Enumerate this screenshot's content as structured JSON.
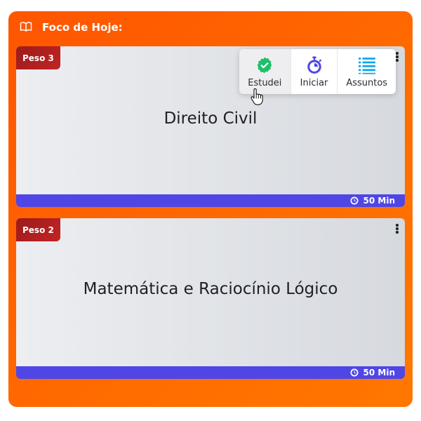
{
  "header": {
    "title": "Foco de Hoje:",
    "icon": "book-open-icon"
  },
  "cards": [
    {
      "peso": "Peso 3",
      "subject": "Direito Civil",
      "duration": "50 Min",
      "toolbar": [
        {
          "label": "Estudei",
          "icon": "check-badge-icon",
          "color": "#1fbf6a"
        },
        {
          "label": "Iniciar",
          "icon": "stopwatch-icon",
          "color": "#4f46e5"
        },
        {
          "label": "Assuntos",
          "icon": "list-icon",
          "color": "#0ea5e9"
        }
      ]
    },
    {
      "peso": "Peso 2",
      "subject": "Matemática e Raciocínio Lógico",
      "duration": "50 Min"
    }
  ],
  "colors": {
    "panel": "#ff6a00",
    "bar": "#4f46e5",
    "peso": "#b01f1f"
  }
}
